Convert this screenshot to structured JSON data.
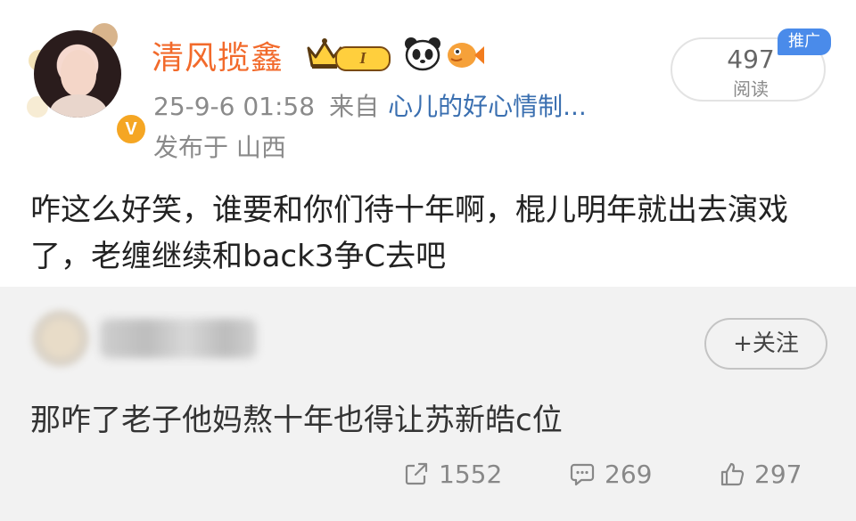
{
  "post": {
    "username": "清风揽鑫",
    "level_badge": "I",
    "timestamp": "25-9-6 01:58",
    "from_label": "来自",
    "source": "心儿的好心情制...",
    "location": "发布于 山西",
    "reads_count": "497",
    "reads_label": "阅读",
    "promo_tag": "推广",
    "text": "咋这么好笑，谁要和你们待十年啊，棍儿明年就出去演戏了，老缠继续和back3争C去吧"
  },
  "comment": {
    "follow_label": "+关注",
    "text": "那咋了老子他妈熬十年也得让苏新皓c位"
  },
  "stats": {
    "reposts": "1552",
    "comments": "269",
    "likes": "297"
  },
  "colors": {
    "username": "#f26a2b",
    "link": "#3a6fb0",
    "promo": "#4a8bea",
    "verified": "#f5a623",
    "comment_bg": "#f2f2f2"
  },
  "icons": {
    "verified": "verified-v-icon",
    "crown": "crown-badge-icon",
    "panda": "panda-icon",
    "fish": "fish-icon",
    "repost": "repost-icon",
    "comment": "comment-icon",
    "like": "thumbs-up-icon"
  }
}
